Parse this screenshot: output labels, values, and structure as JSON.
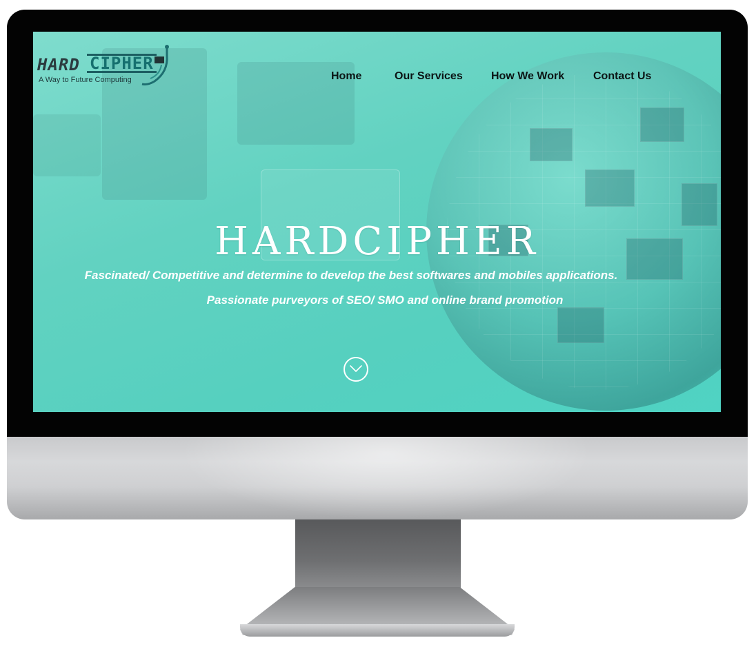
{
  "logo": {
    "word_hard": "HARD",
    "word_cipher": "CIPHER",
    "tagline": "A Way to Future Computing",
    "accent_color": "#16706f"
  },
  "nav": {
    "items": [
      {
        "label": "Home"
      },
      {
        "label": "Our Services"
      },
      {
        "label": "How We Work"
      },
      {
        "label": "Contact Us"
      }
    ]
  },
  "hero": {
    "title": "HARDCIPHER",
    "line1": "Fascinated/ Competitive and determine to develop the best softwares and mobiles applications.",
    "line2": "Passionate purveyors of SEO/ SMO and online brand promotion",
    "scroll_icon": "chevron-down-circle-icon"
  },
  "theme": {
    "screen_color": "#56d0bf",
    "text_color": "#ffffff",
    "nav_text_color": "#0b1414"
  }
}
